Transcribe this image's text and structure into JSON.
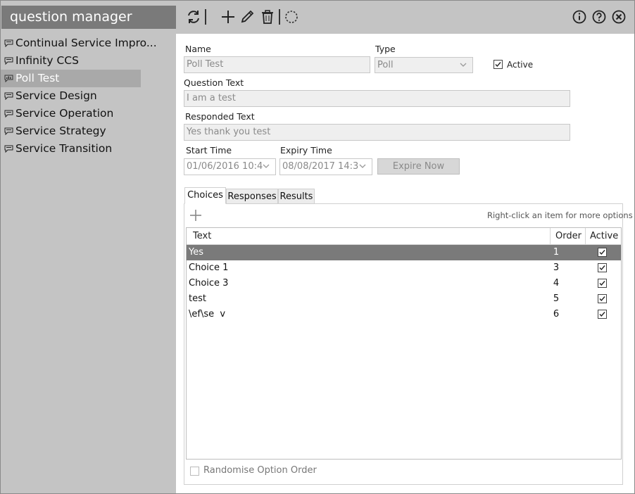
{
  "app": {
    "title": "question manager"
  },
  "sidebar": {
    "items": [
      {
        "label": "Continual Service Impro...",
        "icon": "speech-bubble-icon"
      },
      {
        "label": "Infinity CCS",
        "icon": "speech-bubble-icon"
      },
      {
        "label": "Poll Test",
        "icon": "poll-chart-icon",
        "selected": true
      },
      {
        "label": "Service Design",
        "icon": "speech-bubble-icon"
      },
      {
        "label": "Service Operation",
        "icon": "speech-bubble-icon"
      },
      {
        "label": "Service Strategy",
        "icon": "speech-bubble-icon"
      },
      {
        "label": "Service Transition",
        "icon": "speech-bubble-icon"
      }
    ]
  },
  "toolbar": {
    "left_icons": [
      "refresh-icon",
      "add-icon",
      "edit-pencil-icon",
      "delete-trash-icon",
      "loading-circle-icon"
    ],
    "right_icons": [
      "info-icon",
      "help-icon",
      "close-icon"
    ]
  },
  "form": {
    "name_label": "Name",
    "name_value": "Poll Test",
    "type_label": "Type",
    "type_value": "Poll",
    "active_label": "Active",
    "active_checked": true,
    "question_label": "Question Text",
    "question_value": "I am a test",
    "responded_label": "Responded Text",
    "responded_value": "Yes thank you test",
    "start_label": "Start Time",
    "start_value": "01/06/2016 10:4",
    "expiry_label": "Expiry Time",
    "expiry_value": "08/08/2017 14:3",
    "expire_now_label": "Expire Now"
  },
  "tabs": [
    {
      "label": "Choices",
      "active": true
    },
    {
      "label": "Responses",
      "active": false
    },
    {
      "label": "Results",
      "active": false
    }
  ],
  "choices": {
    "hint": "Right-click an item for more options",
    "columns": {
      "text": "Text",
      "order": "Order",
      "active": "Active"
    },
    "rows": [
      {
        "text": "Yes",
        "order": "1",
        "active": true,
        "selected": true
      },
      {
        "text": "Choice 1",
        "order": "3",
        "active": true
      },
      {
        "text": "Choice 3",
        "order": "4",
        "active": true
      },
      {
        "text": "test",
        "order": "5",
        "active": true
      },
      {
        "text": "\\ef\\se  v",
        "order": "6",
        "active": true
      }
    ],
    "randomise_label": "Randomise Option Order",
    "randomise_checked": false
  },
  "colors": {
    "sidebar_bg": "#c4c4c4",
    "title_bg": "#7a7a7a",
    "selected_nav_bg": "#a9a9a9",
    "selected_row_bg": "#7a7a7a"
  }
}
